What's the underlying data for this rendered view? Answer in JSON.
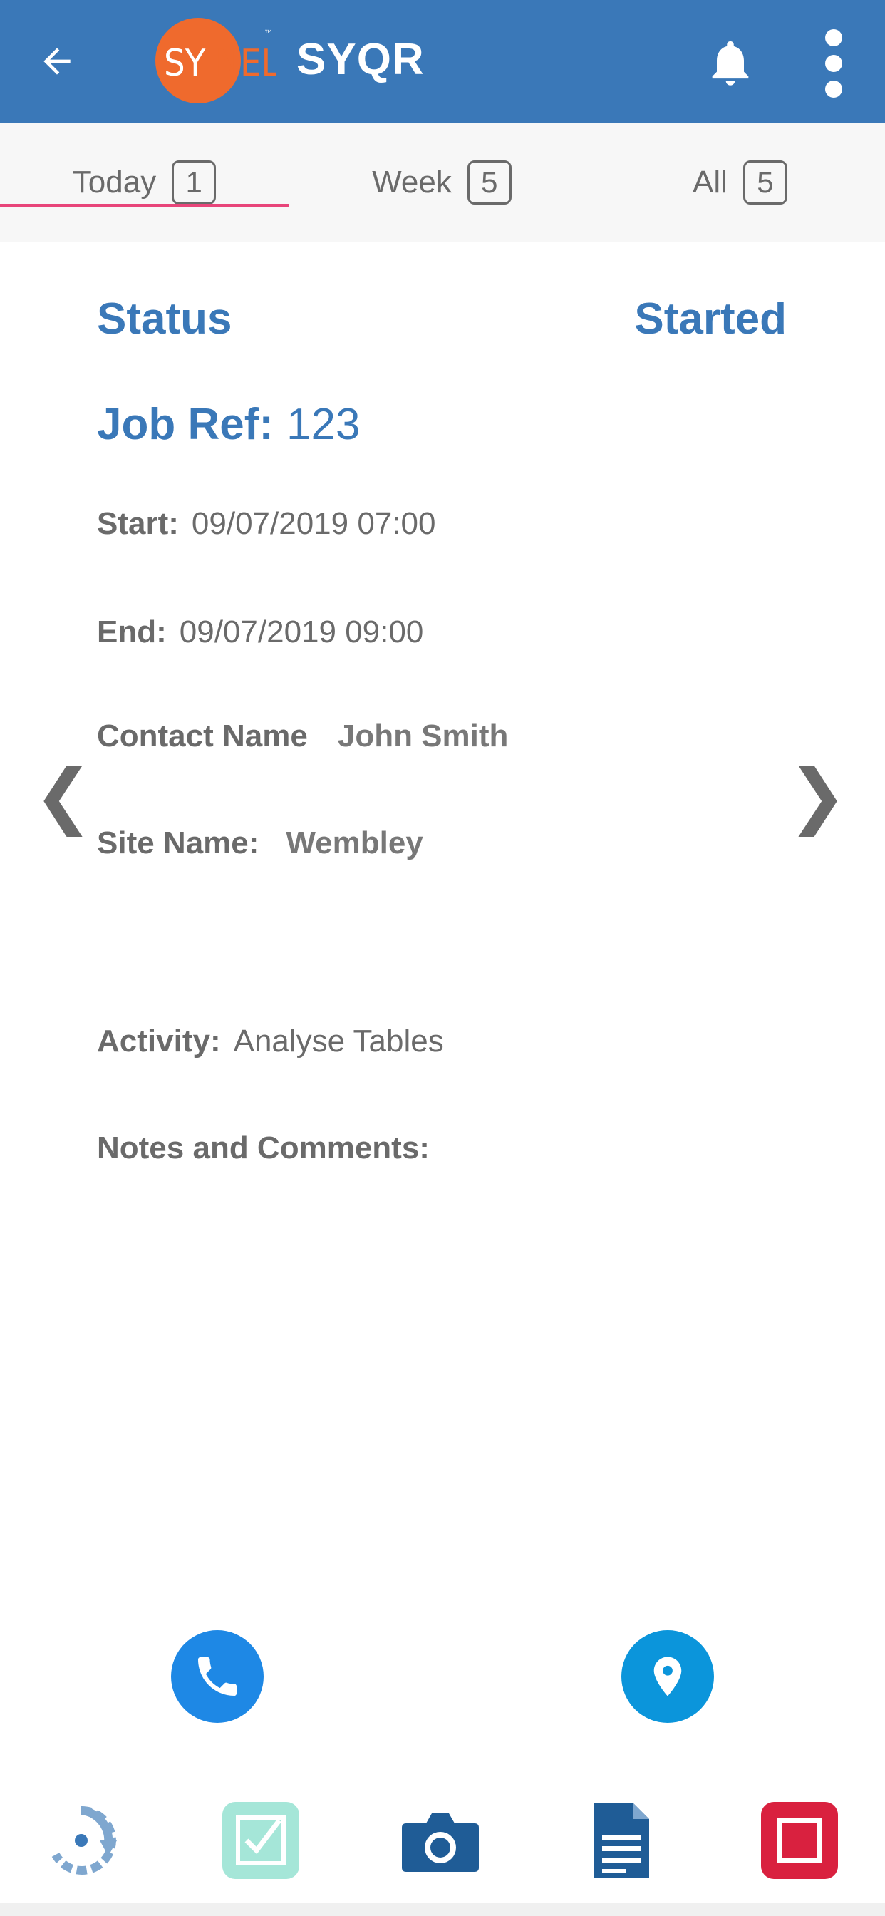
{
  "appbar": {
    "logo_text_left": "SY",
    "logo_text_right": "NEL",
    "logo_tm": "™",
    "title": "SYQR",
    "back_icon": "arrow-left-icon",
    "bell_icon": "bell-icon",
    "more_icon": "more-vert-icon",
    "color": "#3a78b8"
  },
  "tabs": [
    {
      "label": "Today",
      "count": "1",
      "selected": true
    },
    {
      "label": "Week",
      "count": "5",
      "selected": false
    },
    {
      "label": "All",
      "count": "5",
      "selected": false
    }
  ],
  "tab_indicator_color": "#e8457a",
  "job": {
    "status_label": "Status",
    "status_value": "Started",
    "jobref_label": "Job Ref:",
    "jobref_value": "123",
    "start_label": "Start:",
    "start_value": "09/07/2019 07:00",
    "end_label": "End:",
    "end_value": "09/07/2019 09:00",
    "contact_label": "Contact Name",
    "contact_value": "John Smith",
    "site_label": "Site Name:",
    "site_value": "Wembley",
    "activity_label": "Activity:",
    "activity_value": "Analyse Tables",
    "notes_label": "Notes and Comments:"
  },
  "nav": {
    "prev_glyph": "❮",
    "next_glyph": "❯"
  },
  "actions": {
    "call_icon": "phone-icon",
    "map_icon": "map-pin-icon"
  },
  "bottombar": {
    "items": [
      "refresh-icon",
      "checkbox-icon",
      "camera-icon",
      "document-icon",
      "stop-icon"
    ]
  }
}
